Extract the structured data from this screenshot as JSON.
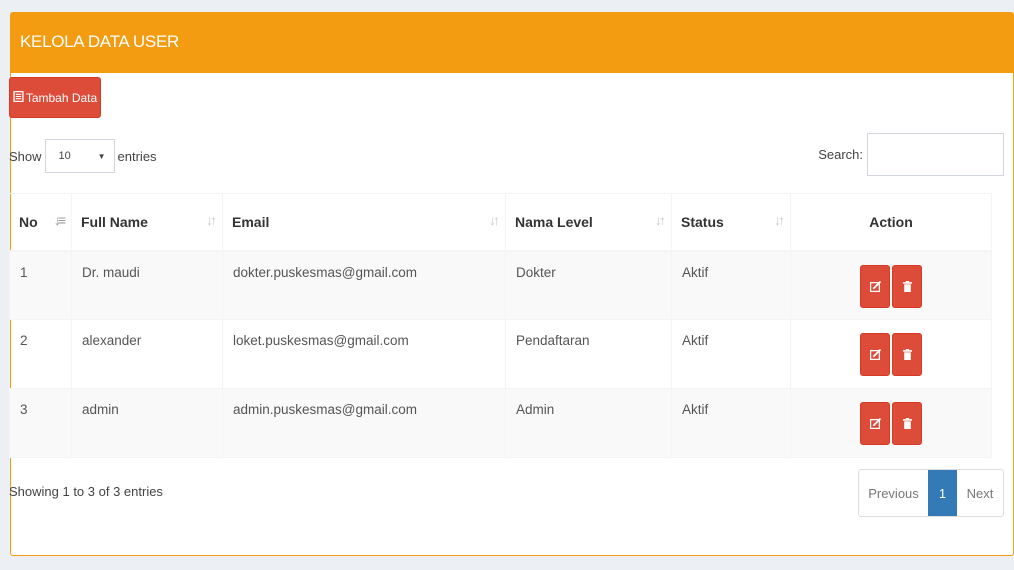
{
  "panel": {
    "title": "KELOLA DATA USER"
  },
  "toolbar": {
    "add_label": "Tambah Data"
  },
  "length_menu": {
    "show_label": "Show",
    "selected": "10",
    "entries_label": "entries"
  },
  "search": {
    "label": "Search:",
    "value": ""
  },
  "table": {
    "headers": [
      "No",
      "Full Name",
      "Email",
      "Nama Level",
      "Status",
      "Action"
    ],
    "rows": [
      {
        "no": "1",
        "full_name": "Dr. maudi",
        "email": "dokter.puskesmas@gmail.com",
        "level": "Dokter",
        "status": "Aktif"
      },
      {
        "no": "2",
        "full_name": "alexander",
        "email": "loket.puskesmas@gmail.com",
        "level": "Pendaftaran",
        "status": "Aktif"
      },
      {
        "no": "3",
        "full_name": "admin",
        "email": "admin.puskesmas@gmail.com",
        "level": "Admin",
        "status": "Aktif"
      }
    ]
  },
  "footer": {
    "info": "Showing 1 to 3 of 3 entries"
  },
  "pagination": {
    "previous": "Previous",
    "current": "1",
    "next": "Next"
  },
  "colors": {
    "header": "#f39c12",
    "danger": "#dd4b39",
    "primary": "#337ab7"
  },
  "icons": {
    "add": "file-icon",
    "edit": "edit-icon",
    "delete": "trash-icon"
  }
}
